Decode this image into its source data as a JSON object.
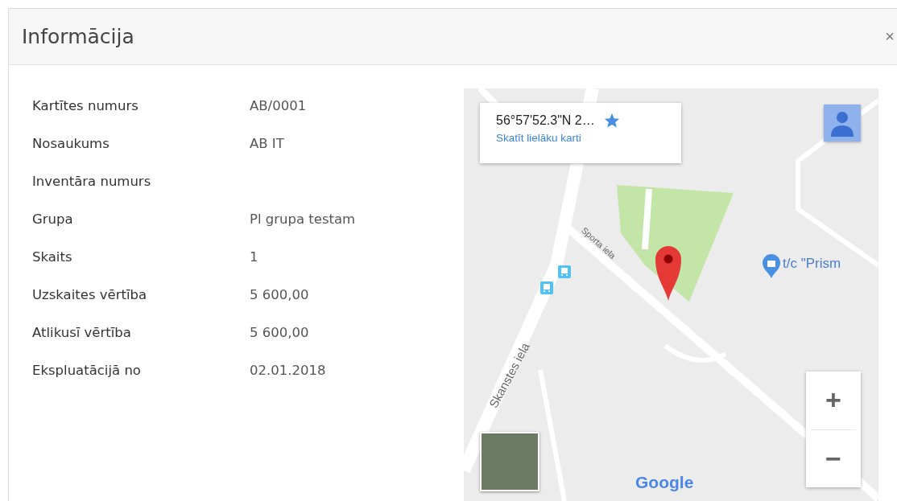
{
  "dialog": {
    "title": "Informācija",
    "close": "×"
  },
  "fields": [
    {
      "label": "Kartītes numurs",
      "value": "AB/0001"
    },
    {
      "label": "Nosaukums",
      "value": "AB IT"
    },
    {
      "label": "Inventāra numurs"
    },
    {
      "label": "Grupa",
      "value": "Pl grupa testam"
    },
    {
      "label": "Skaits",
      "value": "1"
    },
    {
      "label": "Uzskaites vērtība",
      "value": "5 600,00"
    },
    {
      "label": "Atlikusī vērtība",
      "value": "5 600,00"
    },
    {
      "label": "Ekspluatācijā no",
      "value": "02.01.2018"
    }
  ],
  "map": {
    "place_card": {
      "coordinates": "56°57'52.3\"N 2…",
      "link": "Skatīt lielāku karti"
    },
    "labels": [
      {
        "text": "Sporta iela",
        "kind": "street-a"
      },
      {
        "text": "Skanstes iela",
        "kind": "street-b"
      }
    ],
    "poi": "t/c \"Prism",
    "logo": "Google",
    "zoom_in": "+",
    "zoom_out": "−"
  }
}
